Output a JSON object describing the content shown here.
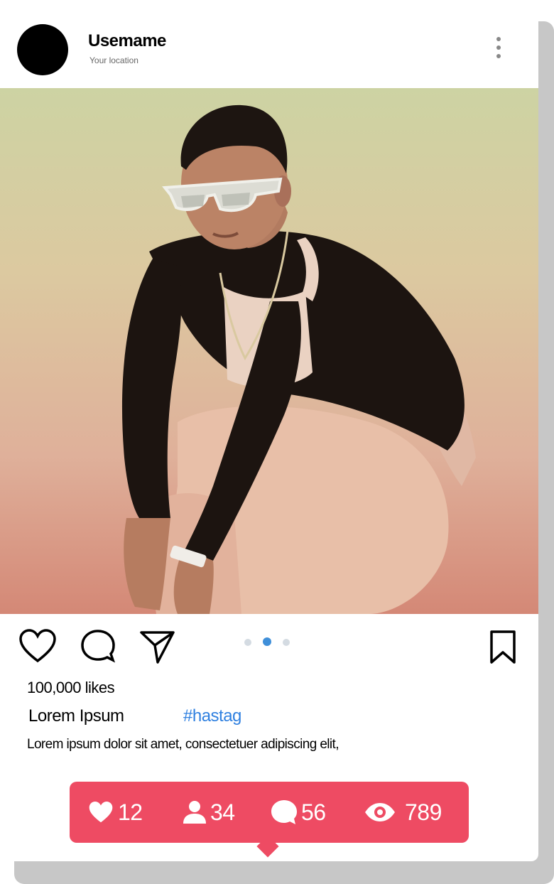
{
  "post": {
    "username": "Usemame",
    "location": "Your location",
    "likes": "100,000 likes",
    "caption_user": "Lorem Ipsum",
    "hashtag": "#hastag",
    "caption_text": "Lorem ipsum dolor sit amet, consectetuer adipiscing elit,"
  },
  "carousel": {
    "count": 3,
    "active_index": 1
  },
  "stats": {
    "likes": "12",
    "followers": "34",
    "comments": "56",
    "views": "789"
  },
  "colors": {
    "accent_stats": "#ee4b63",
    "hashtag": "#2f80e0",
    "active_dot": "#3f8fd9"
  },
  "icons": [
    "heart-icon",
    "comment-icon",
    "share-icon",
    "bookmark-icon",
    "more-icon",
    "user-icon",
    "eye-icon"
  ]
}
